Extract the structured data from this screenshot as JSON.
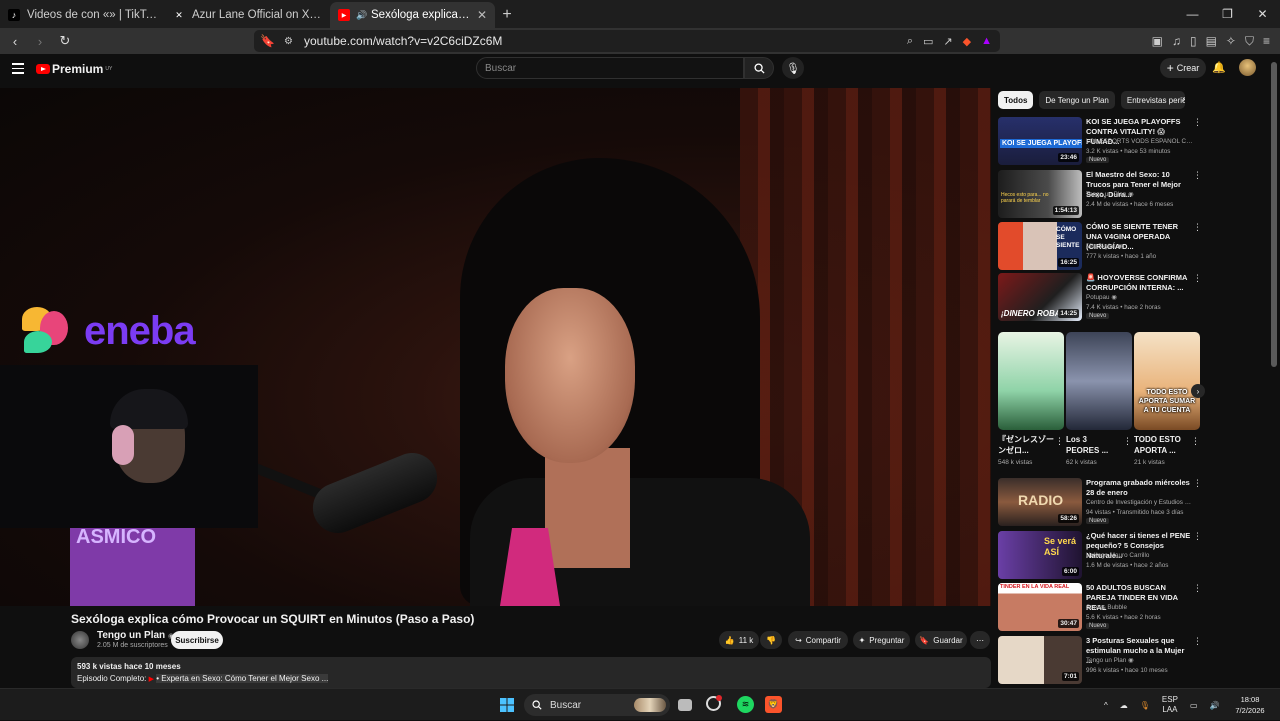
{
  "browser": {
    "tabs": [
      {
        "title": "Videos de con «» | TikTok",
        "icon": "tiktok-icon"
      },
      {
        "title": "Azur Lane Official on X: \"[Preview: Fr",
        "icon": "x-icon"
      },
      {
        "title": "Sexóloga explica cómo Provoc",
        "icon": "youtube-icon",
        "active": true
      }
    ],
    "url": "youtube.com/watch?v=v2C6ciDZc6M"
  },
  "youtube": {
    "logo_text": "Premium",
    "logo_region": "UY",
    "search_placeholder": "Buscar",
    "create_label": "Crear"
  },
  "player": {
    "sponsor_text": "eneba",
    "sign_text": "ÁSMICO"
  },
  "video": {
    "title": "Sexóloga explica cómo Provocar un SQUIRT en Minutos (Paso a Paso)",
    "channel": "Tengo un Plan",
    "subscribers": "2.05 M de suscriptores",
    "subscribe_label": "Suscribirse",
    "likes": "11 k",
    "share_label": "Compartir",
    "ask_label": "Preguntar",
    "save_label": "Guardar",
    "views_date": "593 k vistas  hace 10 meses",
    "episode_prefix": "Episodio Completo:",
    "episode_link": "• Experta en Sexo: Cómo Tener el Mejor Sexo ..."
  },
  "sidebar": {
    "chips": [
      "Todos",
      "De Tengo un Plan",
      "Entrevistas periódi"
    ],
    "recommendations": [
      {
        "title": "KOI SE JUEGA PLAYOFFS CONTRA VITALITY! 😱FUMAD...",
        "channel": "LOL ESPORTS VODS ESPAÑOL CASTEO...",
        "meta": "3.2 K vistas • hace 53 minutos",
        "duration": "23:46",
        "badge": "Nuevo",
        "thumb_text": "KOI SE JUEGA PLAYOFFS"
      },
      {
        "title": "El Maestro del Sexo: 10 Trucos para Tener el Mejor Sexo, Dura...",
        "channel": "Tengo un Plan ◉",
        "meta": "2.4 M de vistas • hace 6 meses",
        "duration": "1:54:13",
        "badge": "",
        "thumb_text": "Hecos esto para... no parará de temblar"
      },
      {
        "title": "CÓMO SE SIENTE TENER UNA V4GIN4 OPERADA (CIRUGÍA D...",
        "channel": "Mia Skylar ◉",
        "meta": "777 k vistas • hace 1 año",
        "duration": "16:25",
        "badge": "",
        "thumb_text": "CÓMO SE SIENTE"
      },
      {
        "title": "🚨 HOYOVERSE CONFIRMA CORRUPCIÓN INTERNA: ...",
        "channel": "Potupau ◉",
        "meta": "7.4 K vistas • hace 2 horas",
        "duration": "14:25",
        "badge": "Nuevo",
        "thumb_text": "¡DINERO ROBA"
      },
      {
        "title": "Programa grabado miércoles 28 de enero",
        "channel": "Centro de Investigación y Estudios Laca...",
        "meta": "94 vistas • Transmitido hace 3 días",
        "duration": "58:26",
        "badge": "Nuevo",
        "thumb_text": "RADIO"
      },
      {
        "title": "¿Qué hacer si tienes el PENE pequeño? 5 Consejos Naturale...",
        "channel": "Urólogo Mauro Carrillo",
        "meta": "1.6 M de vistas • hace 2 años",
        "duration": "6:00",
        "badge": "",
        "thumb_text": "Se verá ASÍ"
      },
      {
        "title": "50 ADULTOS BUSCAN PAREJA TINDER EN VIDA REAL",
        "channel": "Somos Bubble",
        "meta": "5.6 K vistas • hace 2 horas",
        "duration": "30:47",
        "badge": "Nuevo",
        "thumb_text": "TINDER EN LA VIDA REAL"
      },
      {
        "title": "3 Posturas Sexuales que estimulan mucho a la Mujer ...",
        "channel": "Tengo un Plan ◉",
        "meta": "996 k vistas • hace 10 meses",
        "duration": "7:01",
        "badge": "",
        "thumb_text": ""
      }
    ],
    "shorts": [
      {
        "title": "『ゼンレスゾーンゼロ...",
        "views": "548 k vistas"
      },
      {
        "title": "Los 3 PEORES ...",
        "views": "62 k vistas"
      },
      {
        "title": "TODO ESTO APORTA ...",
        "views": "21 k vistas",
        "thumb_text": "TODO ESTO APORTA SUMAR A TU CUENTA"
      }
    ]
  },
  "taskbar": {
    "search_label": "Buscar",
    "lang_line1": "ESP",
    "lang_line2": "LAA",
    "time": "18:08",
    "date": "7/2/2026"
  }
}
